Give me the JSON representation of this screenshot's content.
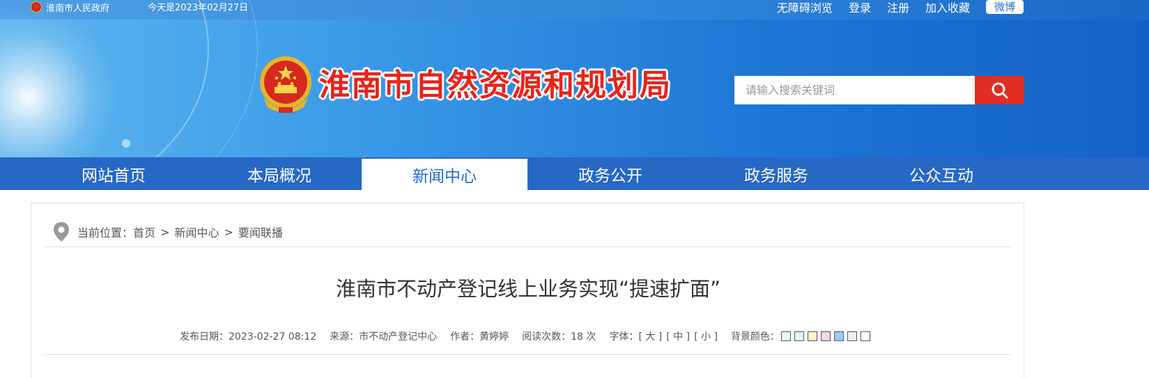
{
  "topbar": {
    "gov_link": "淮南市人民政府",
    "date_text": "今天是2023年02月27日",
    "links": [
      "无障碍浏览",
      "登录",
      "注册",
      "加入收藏"
    ],
    "weibo": "微博"
  },
  "header": {
    "site_title": "淮南市自然资源和规划局",
    "search_placeholder": "请输入搜索关键词"
  },
  "nav": {
    "items": [
      {
        "label": "网站首页"
      },
      {
        "label": "本局概况"
      },
      {
        "label": "新闻中心"
      },
      {
        "label": "政务公开"
      },
      {
        "label": "政务服务"
      },
      {
        "label": "公众互动"
      }
    ],
    "active_index": 2
  },
  "breadcrumb": {
    "prefix": "当前位置：",
    "items": [
      "首页",
      "新闻中心",
      "要闻联播"
    ],
    "separator": ">"
  },
  "article": {
    "title": "淮南市不动产登记线上业务实现“提速扩面”",
    "publish_label": "发布日期：2023-02-27 08:12",
    "source_label": "来源：市不动产登记中心",
    "author_label": "作者：黄婷婷",
    "reads_label": "阅读次数：18 次",
    "font_label": "字体：",
    "font_sizes": [
      "[ 大 ]",
      "[ 中 ]",
      "[ 小 ]"
    ],
    "bg_label": "背景颜色：",
    "bg_colors": [
      "#e7f7fb",
      "#dff6f6",
      "#fbf6c8",
      "#f8d3f0",
      "#9ec7f6",
      "#eeeeee",
      "#ffffff"
    ]
  },
  "colors": {
    "nav_bg": "#2768c5",
    "search_btn": "#e02e24",
    "title_red": "#e8231b"
  }
}
